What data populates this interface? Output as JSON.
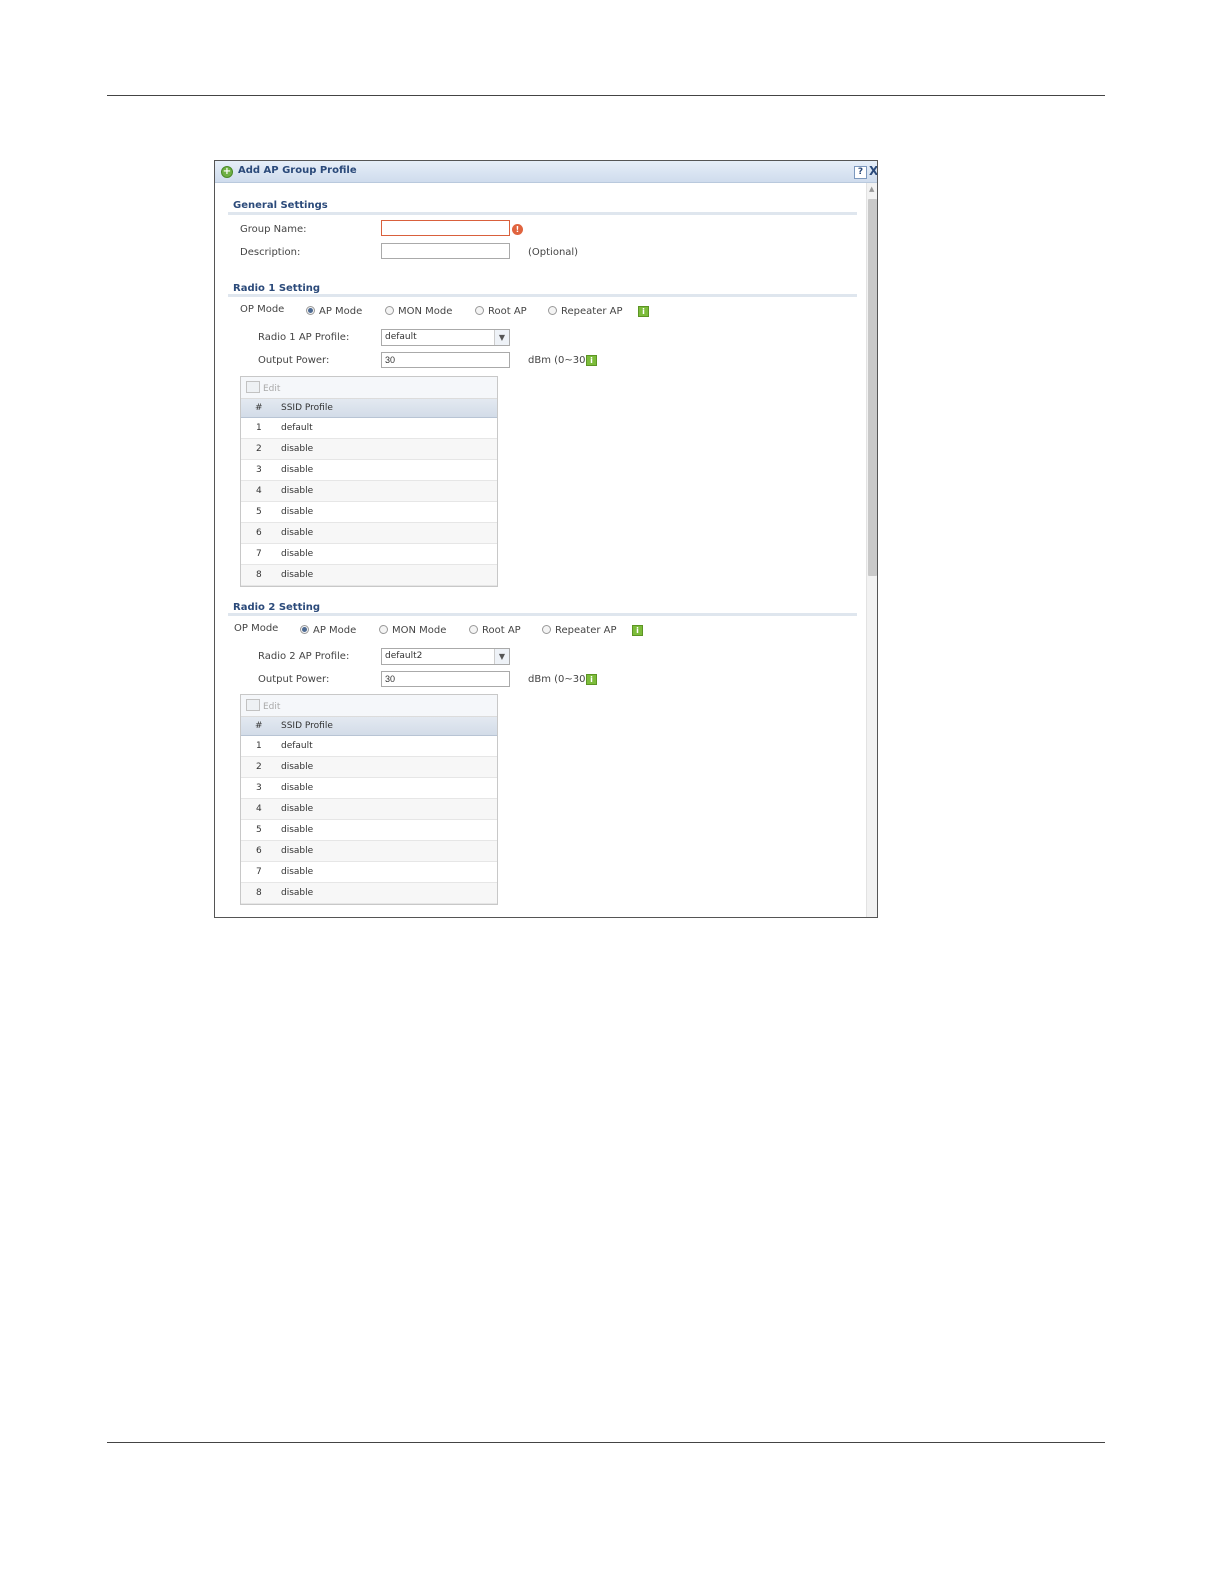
{
  "dialog": {
    "title": "Add AP Group Profile",
    "help_label": "?",
    "close_label": "X"
  },
  "general": {
    "section_title": "General Settings",
    "group_name_label": "Group Name:",
    "group_name_value": "",
    "description_label": "Description:",
    "description_value": "",
    "optional_label": "(Optional)"
  },
  "radio1": {
    "section_title": "Radio 1 Setting",
    "op_mode_label": "OP Mode",
    "modes": [
      "AP Mode",
      "MON Mode",
      "Root AP",
      "Repeater AP"
    ],
    "selected_mode": "AP Mode",
    "profile_label": "Radio 1 AP Profile:",
    "profile_value": "default",
    "output_power_label": "Output Power:",
    "output_power_value": "30",
    "output_power_unit": "dBm (0~30)",
    "edit_label": "Edit",
    "table_headers": [
      "#",
      "SSID Profile"
    ],
    "rows": [
      {
        "num": "1",
        "ssid": "default"
      },
      {
        "num": "2",
        "ssid": "disable"
      },
      {
        "num": "3",
        "ssid": "disable"
      },
      {
        "num": "4",
        "ssid": "disable"
      },
      {
        "num": "5",
        "ssid": "disable"
      },
      {
        "num": "6",
        "ssid": "disable"
      },
      {
        "num": "7",
        "ssid": "disable"
      },
      {
        "num": "8",
        "ssid": "disable"
      }
    ]
  },
  "radio2": {
    "section_title": "Radio 2 Setting",
    "op_mode_label": "OP Mode",
    "modes": [
      "AP Mode",
      "MON Mode",
      "Root AP",
      "Repeater AP"
    ],
    "selected_mode": "AP Mode",
    "profile_label": "Radio 2 AP Profile:",
    "profile_value": "default2",
    "output_power_label": "Output Power:",
    "output_power_value": "30",
    "output_power_unit": "dBm (0~30)",
    "edit_label": "Edit",
    "table_headers": [
      "#",
      "SSID Profile"
    ],
    "rows": [
      {
        "num": "1",
        "ssid": "default"
      },
      {
        "num": "2",
        "ssid": "disable"
      },
      {
        "num": "3",
        "ssid": "disable"
      },
      {
        "num": "4",
        "ssid": "disable"
      },
      {
        "num": "5",
        "ssid": "disable"
      },
      {
        "num": "6",
        "ssid": "disable"
      },
      {
        "num": "7",
        "ssid": "disable"
      },
      {
        "num": "8",
        "ssid": "disable"
      }
    ]
  }
}
